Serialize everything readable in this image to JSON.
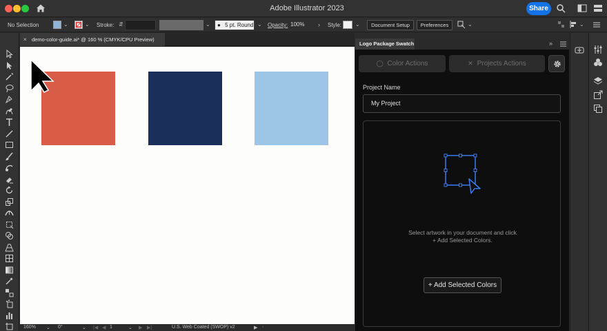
{
  "titlebar": {
    "app_title": "Adobe Illustrator 2023",
    "share_label": "Share"
  },
  "controlbar": {
    "selection": "No Selection",
    "stroke_label": "Stroke:",
    "brush_value": "5 pt. Round",
    "opacity_label": "Opacity:",
    "opacity_value": "100%",
    "style_label": "Style:",
    "document_setup": "Document Setup",
    "preferences": "Preferences"
  },
  "document": {
    "tab_label": "demo-color-guide.ai* @ 160 % (CMYK/CPU Preview)",
    "tab_close": "×"
  },
  "artwork": {
    "colors": [
      "#d95c48",
      "#1b2f5b",
      "#9cc5e8"
    ]
  },
  "statusbar": {
    "zoom": "160%",
    "rotation": "0°",
    "artboard": "1",
    "profile": "U.S. Web Coated (SWOP) v2"
  },
  "panel": {
    "tab_label": "Logo Package Swatch",
    "color_actions": "Color Actions",
    "projects_actions": "Projects Actions",
    "project_name_label": "Project Name",
    "project_name_value": "My Project",
    "help_line1": "Select artwork in your document and click",
    "help_line2": "+ Add Selected Colors.",
    "add_button": "+ Add Selected Colors"
  },
  "accent": "#3a7bf0"
}
